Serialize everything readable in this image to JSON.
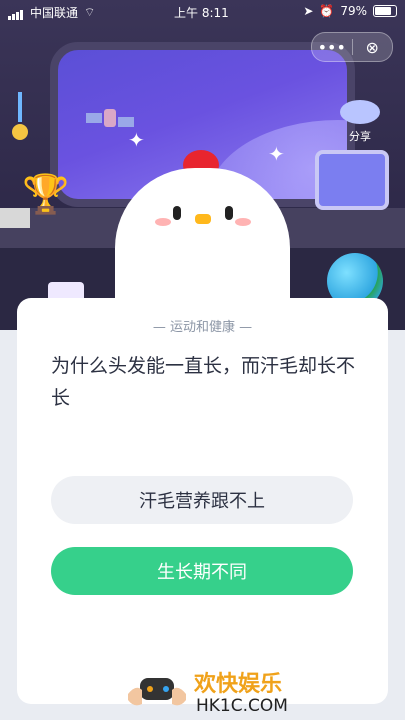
{
  "status_bar": {
    "carrier": "中国联通",
    "time": "上午 8:11",
    "battery": "79%"
  },
  "capsule": {
    "more_icon": "more-dots-icon",
    "close_icon": "close-circle-icon"
  },
  "scene": {
    "share_label": "分享"
  },
  "card": {
    "category": "— 运动和健康 —",
    "question": "为什么头发能一直长，而汗毛却长不长",
    "options": [
      {
        "label": "汗毛营养跟不上"
      },
      {
        "label": "生长期不同"
      }
    ]
  },
  "watermark": {
    "cn": "欢快娱乐",
    "en": "HK1C.COM"
  },
  "colors": {
    "accent_green": "#36d08b",
    "option_gray": "#eef0f4",
    "scene_bg": "#3b3558"
  }
}
